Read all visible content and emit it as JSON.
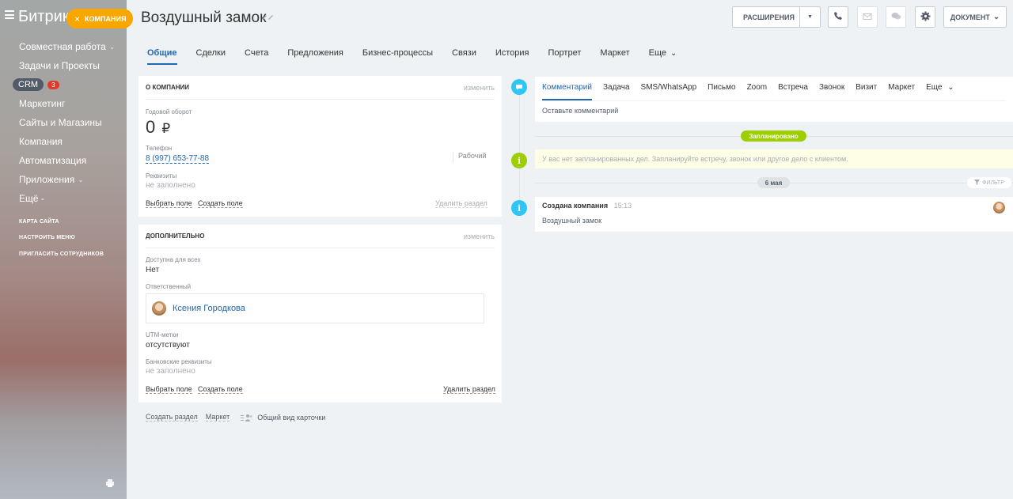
{
  "sidebar": {
    "brand": "Битрикс",
    "company_badge": "КОМПАНИЯ",
    "close_glyph": "×",
    "items": [
      {
        "label": "Совместная работа",
        "arrow": "⌄"
      },
      {
        "label": "Задачи и Проекты"
      },
      {
        "label": "CRM",
        "count": "3"
      },
      {
        "label": "Маркетинг"
      },
      {
        "label": "Сайты и Магазины"
      },
      {
        "label": "Компания"
      },
      {
        "label": "Автоматизация"
      },
      {
        "label": "Приложения",
        "arrow": "⌄"
      },
      {
        "label": "Ещё -"
      }
    ],
    "bottom_links": [
      "КАРТА САЙТА",
      "НАСТРОИТЬ МЕНЮ",
      "ПРИГЛАСИТЬ СОТРУДНИКОВ"
    ]
  },
  "header": {
    "title": "Воздушный замок",
    "extensions_label": "РАСШИРЕНИЯ",
    "document_label": "ДОКУМЕНТ",
    "icons": [
      "phone-icon",
      "mail-icon",
      "chat-icon",
      "gear-icon"
    ]
  },
  "tabs": [
    "Общие",
    "Сделки",
    "Счета",
    "Предложения",
    "Бизнес-процессы",
    "Связи",
    "История",
    "Портрет",
    "Маркет",
    "Еще"
  ],
  "about": {
    "title": "О КОМПАНИИ",
    "edit": "изменить",
    "revenue_label": "Годовой оборот",
    "revenue_value": "0",
    "currency": "₽",
    "phone_label": "Телефон",
    "phone_value": "8 (997) 653-77-88",
    "phone_type": "Рабочий",
    "requisites_label": "Реквизиты",
    "requisites_value": "не заполнено",
    "select_field": "Выбрать поле",
    "create_field": "Создать поле",
    "delete_section": "Удалить раздел"
  },
  "extra": {
    "title": "ДОПОЛНИТЕЛЬНО",
    "edit": "изменить",
    "available_label": "Доступна для всех",
    "available_value": "Нет",
    "responsible_label": "Ответственный",
    "responsible_name": "Ксения Городкова",
    "utm_label": "UTM-метки",
    "utm_value": "отсутствуют",
    "bank_label": "Банковские реквизиты",
    "bank_value": "не заполнено",
    "select_field": "Выбрать поле",
    "create_field": "Создать поле",
    "delete_section": "Удалить раздел"
  },
  "footer": {
    "create_section": "Создать раздел",
    "market": "Маркет",
    "common_view": "Общий вид карточки"
  },
  "timeline": {
    "comment_tabs": [
      "Комментарий",
      "Задача",
      "SMS/WhatsApp",
      "Письмо",
      "Zoom",
      "Встреча",
      "Звонок",
      "Визит",
      "Маркет",
      "Еще"
    ],
    "comment_placeholder": "Оставьте комментарий",
    "planned_label": "Запланировано",
    "no_plans_text": "У вас нет запланированных дел. Запланируйте встречу, звонок или другое дело с клиентом.",
    "date_label": "6 мая",
    "filter_label": "ФИЛЬТР",
    "event_title": "Создана компания",
    "event_time": "15:13",
    "event_subject": "Воздушный замок"
  },
  "colors": {
    "accent": "#2067b0",
    "badge": "#f7a700",
    "planned": "#9dcf00",
    "timeline_dot": "#2fc6f6"
  }
}
